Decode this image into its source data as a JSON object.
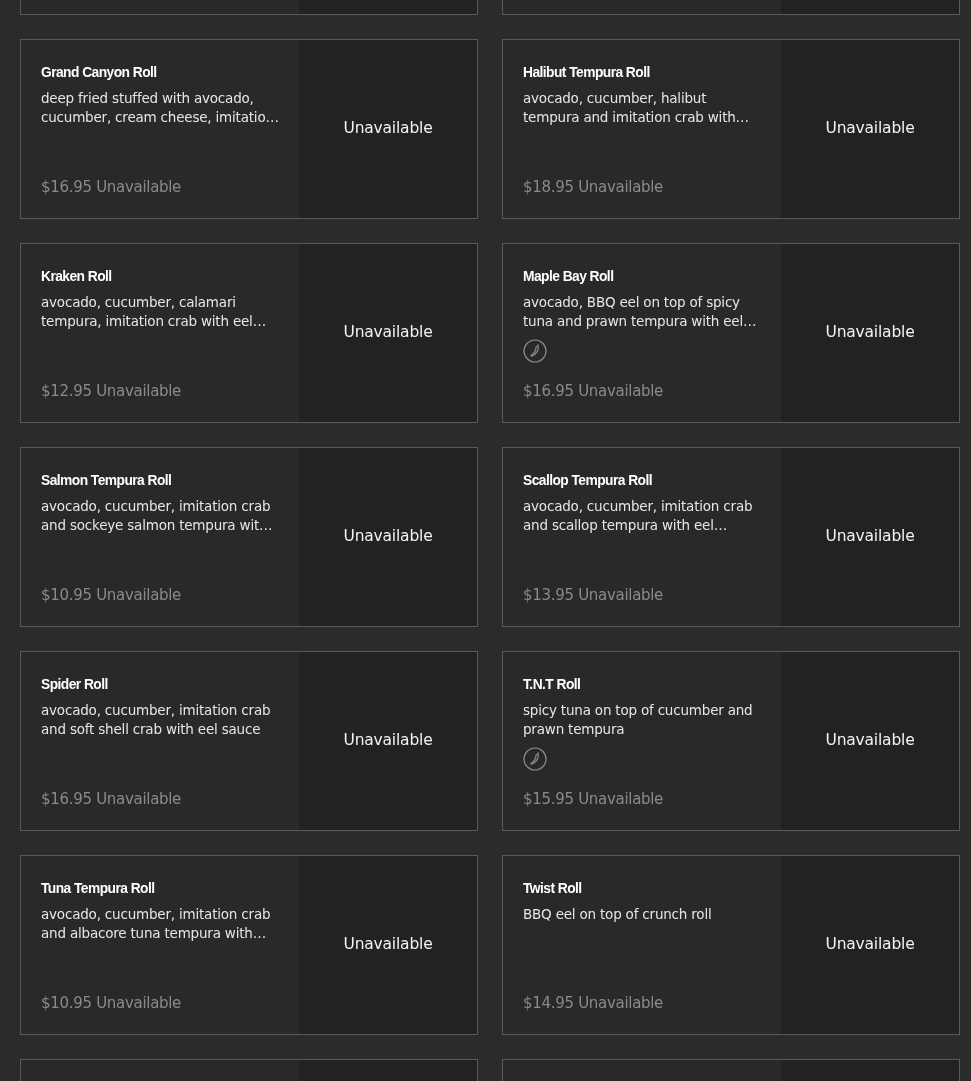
{
  "menu_items": [
    {
      "kind": "cut"
    },
    {
      "kind": "cut"
    },
    {
      "kind": "item",
      "name": "Grand Canyon Roll",
      "description": "deep fried stuffed with avocado, cucumber, cream cheese, imitatio…",
      "spicy": false,
      "price": "$16.95 Unavailable",
      "status": "Unavailable"
    },
    {
      "kind": "item",
      "name": "Halibut Tempura Roll",
      "description": "avocado, cucumber, halibut tempura and imitation crab with…",
      "spicy": false,
      "price": "$18.95 Unavailable",
      "status": "Unavailable"
    },
    {
      "kind": "item",
      "name": "Kraken Roll",
      "description": "avocado, cucumber, calamari tempura, imitation crab with eel…",
      "spicy": false,
      "price": "$12.95 Unavailable",
      "status": "Unavailable"
    },
    {
      "kind": "item",
      "name": "Maple Bay Roll",
      "description": "avocado, BBQ eel on top of spicy tuna and prawn tempura with eel…",
      "spicy": true,
      "price": "$16.95 Unavailable",
      "status": "Unavailable"
    },
    {
      "kind": "item",
      "name": "Salmon Tempura Roll",
      "description": "avocado, cucumber, imitation crab and sockeye salmon tempura wit…",
      "spicy": false,
      "price": "$10.95 Unavailable",
      "status": "Unavailable"
    },
    {
      "kind": "item",
      "name": "Scallop Tempura Roll",
      "description": "avocado, cucumber, imitation crab and scallop tempura with eel…",
      "spicy": false,
      "price": "$13.95 Unavailable",
      "status": "Unavailable"
    },
    {
      "kind": "item",
      "name": "Spider Roll",
      "description": "avocado, cucumber, imitation crab and soft shell crab with eel sauce",
      "spicy": false,
      "price": "$16.95 Unavailable",
      "status": "Unavailable"
    },
    {
      "kind": "item",
      "name": "T.N.T Roll",
      "description": "spicy tuna on top of cucumber and prawn tempura",
      "spicy": true,
      "price": "$15.95 Unavailable",
      "status": "Unavailable"
    },
    {
      "kind": "item",
      "name": "Tuna Tempura Roll",
      "description": "avocado, cucumber, imitation crab and albacore tuna tempura with…",
      "spicy": false,
      "price": "$10.95 Unavailable",
      "status": "Unavailable"
    },
    {
      "kind": "item",
      "name": "Twist Roll",
      "description": "BBQ eel on top of crunch roll",
      "spicy": false,
      "price": "$14.95 Unavailable",
      "status": "Unavailable"
    },
    {
      "kind": "cut"
    },
    {
      "kind": "cut"
    }
  ]
}
